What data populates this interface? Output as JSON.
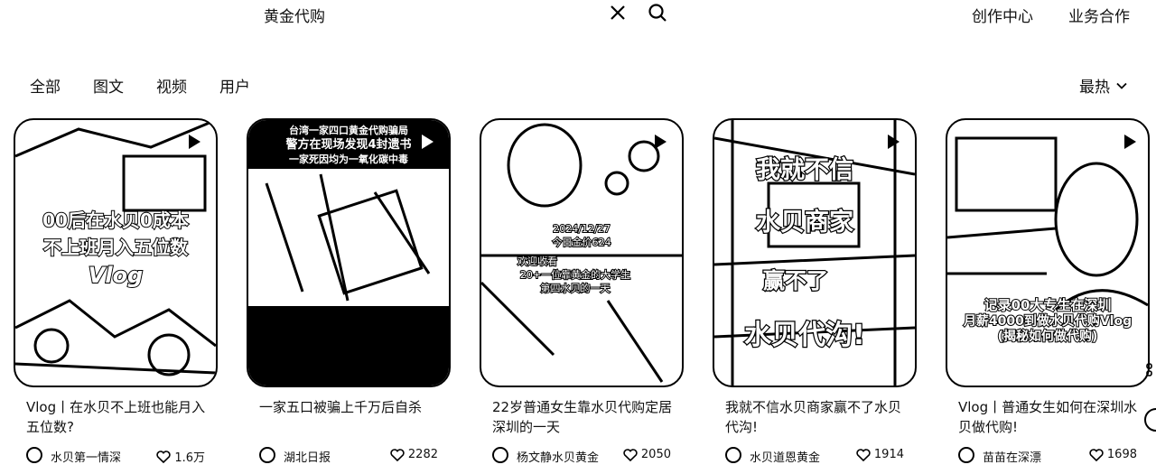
{
  "search": {
    "query": "黄金代购"
  },
  "top_nav": {
    "creator_center": "创作中心",
    "business": "业务合作"
  },
  "filters": {
    "all": "全部",
    "image_text": "图文",
    "video": "视频",
    "users": "用户",
    "sort": "最热"
  },
  "cards": [
    {
      "title": "Vlog丨在水贝不上班也能月入五位数?",
      "author": "水贝第一情深",
      "likes": "1.6万",
      "overlay": [
        "00后在水贝0成本",
        "不上班月入五位数",
        "Vlog"
      ]
    },
    {
      "title": "一家五口被骗上千万后自杀",
      "author": "湖北日报",
      "likes": "2282",
      "overlay": [
        "台湾一家四口黄金代购骗局",
        "警方在现场发现4封遗书",
        "一家死因均为一氧化碳中毒"
      ]
    },
    {
      "title": "22岁普通女生靠水贝代购定居深圳的一天",
      "author": "杨文静水贝黄金",
      "likes": "2050",
      "overlay": [
        "2024/12/27",
        "今日金价624",
        "欢迎收看",
        "20+一位靠黄金的大学生",
        "第四水贝的一天"
      ]
    },
    {
      "title": "我就不信水贝商家赢不了水贝代沟!",
      "author": "水贝道恩黄金",
      "likes": "1914",
      "overlay": [
        "我就不信",
        "水贝商家",
        "赢不了",
        "水贝代沟!"
      ]
    },
    {
      "title": "Vlog丨普通女生如何在深圳水贝做代购!",
      "author": "苗苗在深漂",
      "likes": "1698",
      "overlay": [
        "记录00大专生在深圳",
        "月薪4000到做水贝代购Vlog",
        "(揭秘如何做代购)"
      ]
    }
  ]
}
